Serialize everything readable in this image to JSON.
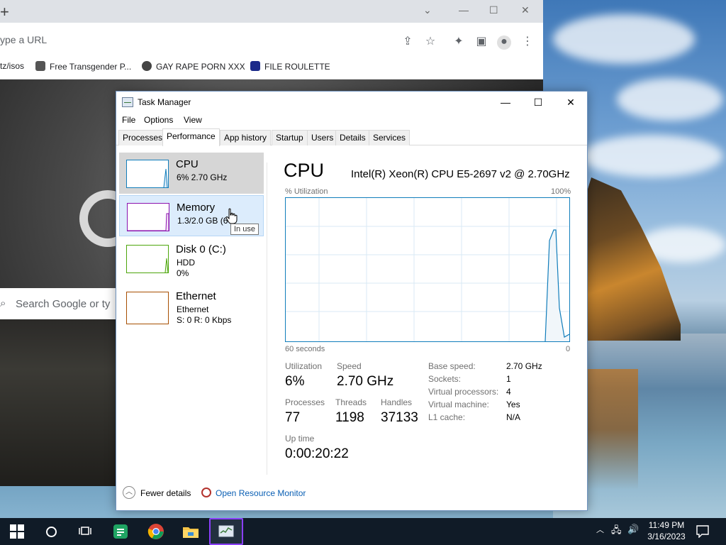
{
  "browser": {
    "omnibox_placeholder": "ype a URL",
    "bookmarks": [
      "tz/isos",
      "Free Transgender P...",
      "GAY RAPE PORN XXX",
      "FILE ROULETTE"
    ],
    "search_placeholder": "Search Google or ty",
    "google_letter": "G"
  },
  "taskmanager": {
    "title": "Task Manager",
    "menu": [
      "File",
      "Options",
      "View"
    ],
    "tabs": [
      "Processes",
      "Performance",
      "App history",
      "Startup",
      "Users",
      "Details",
      "Services"
    ],
    "active_tab": "Performance",
    "nav": [
      {
        "title": "CPU",
        "sub1": "6%  2.70 GHz",
        "sub2": "",
        "sub3": "",
        "color": "#117dbb"
      },
      {
        "title": "Memory",
        "sub1": "1.3/2.0 GB (6",
        "sub2": "",
        "sub3": "",
        "color": "#8b12ae"
      },
      {
        "title": "Disk 0 (C:)",
        "sub1": "HDD",
        "sub2": "0%",
        "sub3": "",
        "color": "#4da60c"
      },
      {
        "title": "Ethernet",
        "sub1": "Ethernet",
        "sub2": "S: 0  R: 0 Kbps",
        "sub3": "",
        "color": "#a74f01"
      }
    ],
    "tooltip": "In use",
    "detail": {
      "title": "CPU",
      "model": "Intel(R) Xeon(R) CPU E5-2697 v2 @ 2.70GHz",
      "graph_label_left": "% Utilization",
      "graph_label_right": "100%",
      "graph_bottom_left": "60 seconds",
      "graph_bottom_right": "0",
      "utilization_label": "Utilization",
      "utilization": "6%",
      "speed_label": "Speed",
      "speed": "2.70 GHz",
      "processes_label": "Processes",
      "processes": "77",
      "threads_label": "Threads",
      "threads": "1198",
      "handles_label": "Handles",
      "handles": "37133",
      "uptime_label": "Up time",
      "uptime": "0:00:20:22",
      "specs": [
        {
          "k": "Base speed:",
          "v": "2.70 GHz"
        },
        {
          "k": "Sockets:",
          "v": "1"
        },
        {
          "k": "Virtual processors:",
          "v": "4"
        },
        {
          "k": "Virtual machine:",
          "v": "Yes"
        },
        {
          "k": "L1 cache:",
          "v": "N/A"
        }
      ]
    },
    "footer": {
      "fewer_details": "Fewer details",
      "resource_monitor": "Open Resource Monitor"
    }
  },
  "taskbar": {
    "time": "11:49 PM",
    "date": "3/16/2023"
  }
}
